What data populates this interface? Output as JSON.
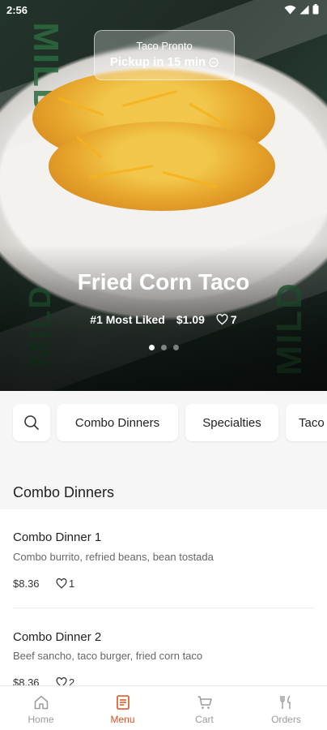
{
  "status_bar": {
    "time": "2:56"
  },
  "hero": {
    "restaurant": "Taco Pronto",
    "pickup_text": "Pickup in 15 min",
    "title": "Fried Corn Taco",
    "rank": "#1 Most Liked",
    "price": "$1.09",
    "likes": "7",
    "slide_count": 3,
    "active_slide": 0
  },
  "categories": {
    "search_icon": "search-icon",
    "items": [
      "Combo Dinners",
      "Specialties",
      "Taco"
    ]
  },
  "section": {
    "title": "Combo Dinners"
  },
  "menu_items": [
    {
      "name": "Combo Dinner 1",
      "description": "Combo burrito, refried beans, bean tostada",
      "price": "$8.36",
      "likes": "1"
    },
    {
      "name": "Combo Dinner 2",
      "description": "Beef sancho, taco burger, fried corn taco",
      "price": "$8.36",
      "likes": "2"
    }
  ],
  "nav": {
    "items": [
      {
        "label": "Home",
        "icon": "home-icon"
      },
      {
        "label": "Menu",
        "icon": "menu-icon"
      },
      {
        "label": "Cart",
        "icon": "cart-icon"
      },
      {
        "label": "Orders",
        "icon": "utensils-icon"
      }
    ],
    "active": "Menu"
  },
  "colors": {
    "accent": "#d9531e"
  }
}
